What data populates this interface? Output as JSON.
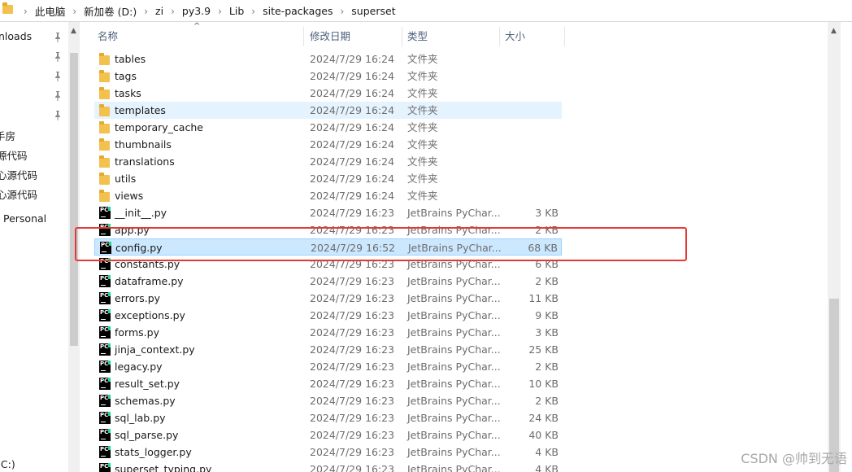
{
  "breadcrumb": [
    "此电脑",
    "新加卷 (D:)",
    "zi",
    "py3.9",
    "Lib",
    "site-packages",
    "superset"
  ],
  "nav": {
    "items": [
      "nloads",
      "",
      "",
      "",
      "",
      "手房",
      "源代码",
      "心源代码",
      "心源代码",
      "Personal",
      "(C:)"
    ]
  },
  "columns": {
    "name": "名称",
    "date": "修改日期",
    "type": "类型",
    "size": "大小"
  },
  "files": [
    {
      "name": "tables",
      "date": "2024/7/29 16:24",
      "type": "文件夹",
      "size": "",
      "kind": "folder"
    },
    {
      "name": "tags",
      "date": "2024/7/29 16:24",
      "type": "文件夹",
      "size": "",
      "kind": "folder"
    },
    {
      "name": "tasks",
      "date": "2024/7/29 16:24",
      "type": "文件夹",
      "size": "",
      "kind": "folder"
    },
    {
      "name": "templates",
      "date": "2024/7/29 16:24",
      "type": "文件夹",
      "size": "",
      "kind": "folder"
    },
    {
      "name": "temporary_cache",
      "date": "2024/7/29 16:24",
      "type": "文件夹",
      "size": "",
      "kind": "folder"
    },
    {
      "name": "thumbnails",
      "date": "2024/7/29 16:24",
      "type": "文件夹",
      "size": "",
      "kind": "folder"
    },
    {
      "name": "translations",
      "date": "2024/7/29 16:24",
      "type": "文件夹",
      "size": "",
      "kind": "folder"
    },
    {
      "name": "utils",
      "date": "2024/7/29 16:24",
      "type": "文件夹",
      "size": "",
      "kind": "folder"
    },
    {
      "name": "views",
      "date": "2024/7/29 16:24",
      "type": "文件夹",
      "size": "",
      "kind": "folder"
    },
    {
      "name": "__init__.py",
      "date": "2024/7/29 16:23",
      "type": "JetBrains PyChar...",
      "size": "3 KB",
      "kind": "py"
    },
    {
      "name": "app.py",
      "date": "2024/7/29 16:23",
      "type": "JetBrains PyChar...",
      "size": "2 KB",
      "kind": "py"
    },
    {
      "name": "config.py",
      "date": "2024/7/29 16:52",
      "type": "JetBrains PyChar...",
      "size": "68 KB",
      "kind": "py"
    },
    {
      "name": "constants.py",
      "date": "2024/7/29 16:23",
      "type": "JetBrains PyChar...",
      "size": "6 KB",
      "kind": "py"
    },
    {
      "name": "dataframe.py",
      "date": "2024/7/29 16:23",
      "type": "JetBrains PyChar...",
      "size": "2 KB",
      "kind": "py"
    },
    {
      "name": "errors.py",
      "date": "2024/7/29 16:23",
      "type": "JetBrains PyChar...",
      "size": "11 KB",
      "kind": "py"
    },
    {
      "name": "exceptions.py",
      "date": "2024/7/29 16:23",
      "type": "JetBrains PyChar...",
      "size": "9 KB",
      "kind": "py"
    },
    {
      "name": "forms.py",
      "date": "2024/7/29 16:23",
      "type": "JetBrains PyChar...",
      "size": "3 KB",
      "kind": "py"
    },
    {
      "name": "jinja_context.py",
      "date": "2024/7/29 16:23",
      "type": "JetBrains PyChar...",
      "size": "25 KB",
      "kind": "py"
    },
    {
      "name": "legacy.py",
      "date": "2024/7/29 16:23",
      "type": "JetBrains PyChar...",
      "size": "2 KB",
      "kind": "py"
    },
    {
      "name": "result_set.py",
      "date": "2024/7/29 16:23",
      "type": "JetBrains PyChar...",
      "size": "10 KB",
      "kind": "py"
    },
    {
      "name": "schemas.py",
      "date": "2024/7/29 16:23",
      "type": "JetBrains PyChar...",
      "size": "2 KB",
      "kind": "py"
    },
    {
      "name": "sql_lab.py",
      "date": "2024/7/29 16:23",
      "type": "JetBrains PyChar...",
      "size": "24 KB",
      "kind": "py"
    },
    {
      "name": "sql_parse.py",
      "date": "2024/7/29 16:23",
      "type": "JetBrains PyChar...",
      "size": "40 KB",
      "kind": "py"
    },
    {
      "name": "stats_logger.py",
      "date": "2024/7/29 16:23",
      "type": "JetBrains PyChar...",
      "size": "4 KB",
      "kind": "py"
    },
    {
      "name": "superset_typing.py",
      "date": "2024/7/29 16:23",
      "type": "JetBrains PyChar...",
      "size": "4 KB",
      "kind": "py"
    }
  ],
  "hover_row": "templates",
  "selected_row": "config.py",
  "highlight_color": "#e53935",
  "watermark": "CSDN @帅到无语"
}
